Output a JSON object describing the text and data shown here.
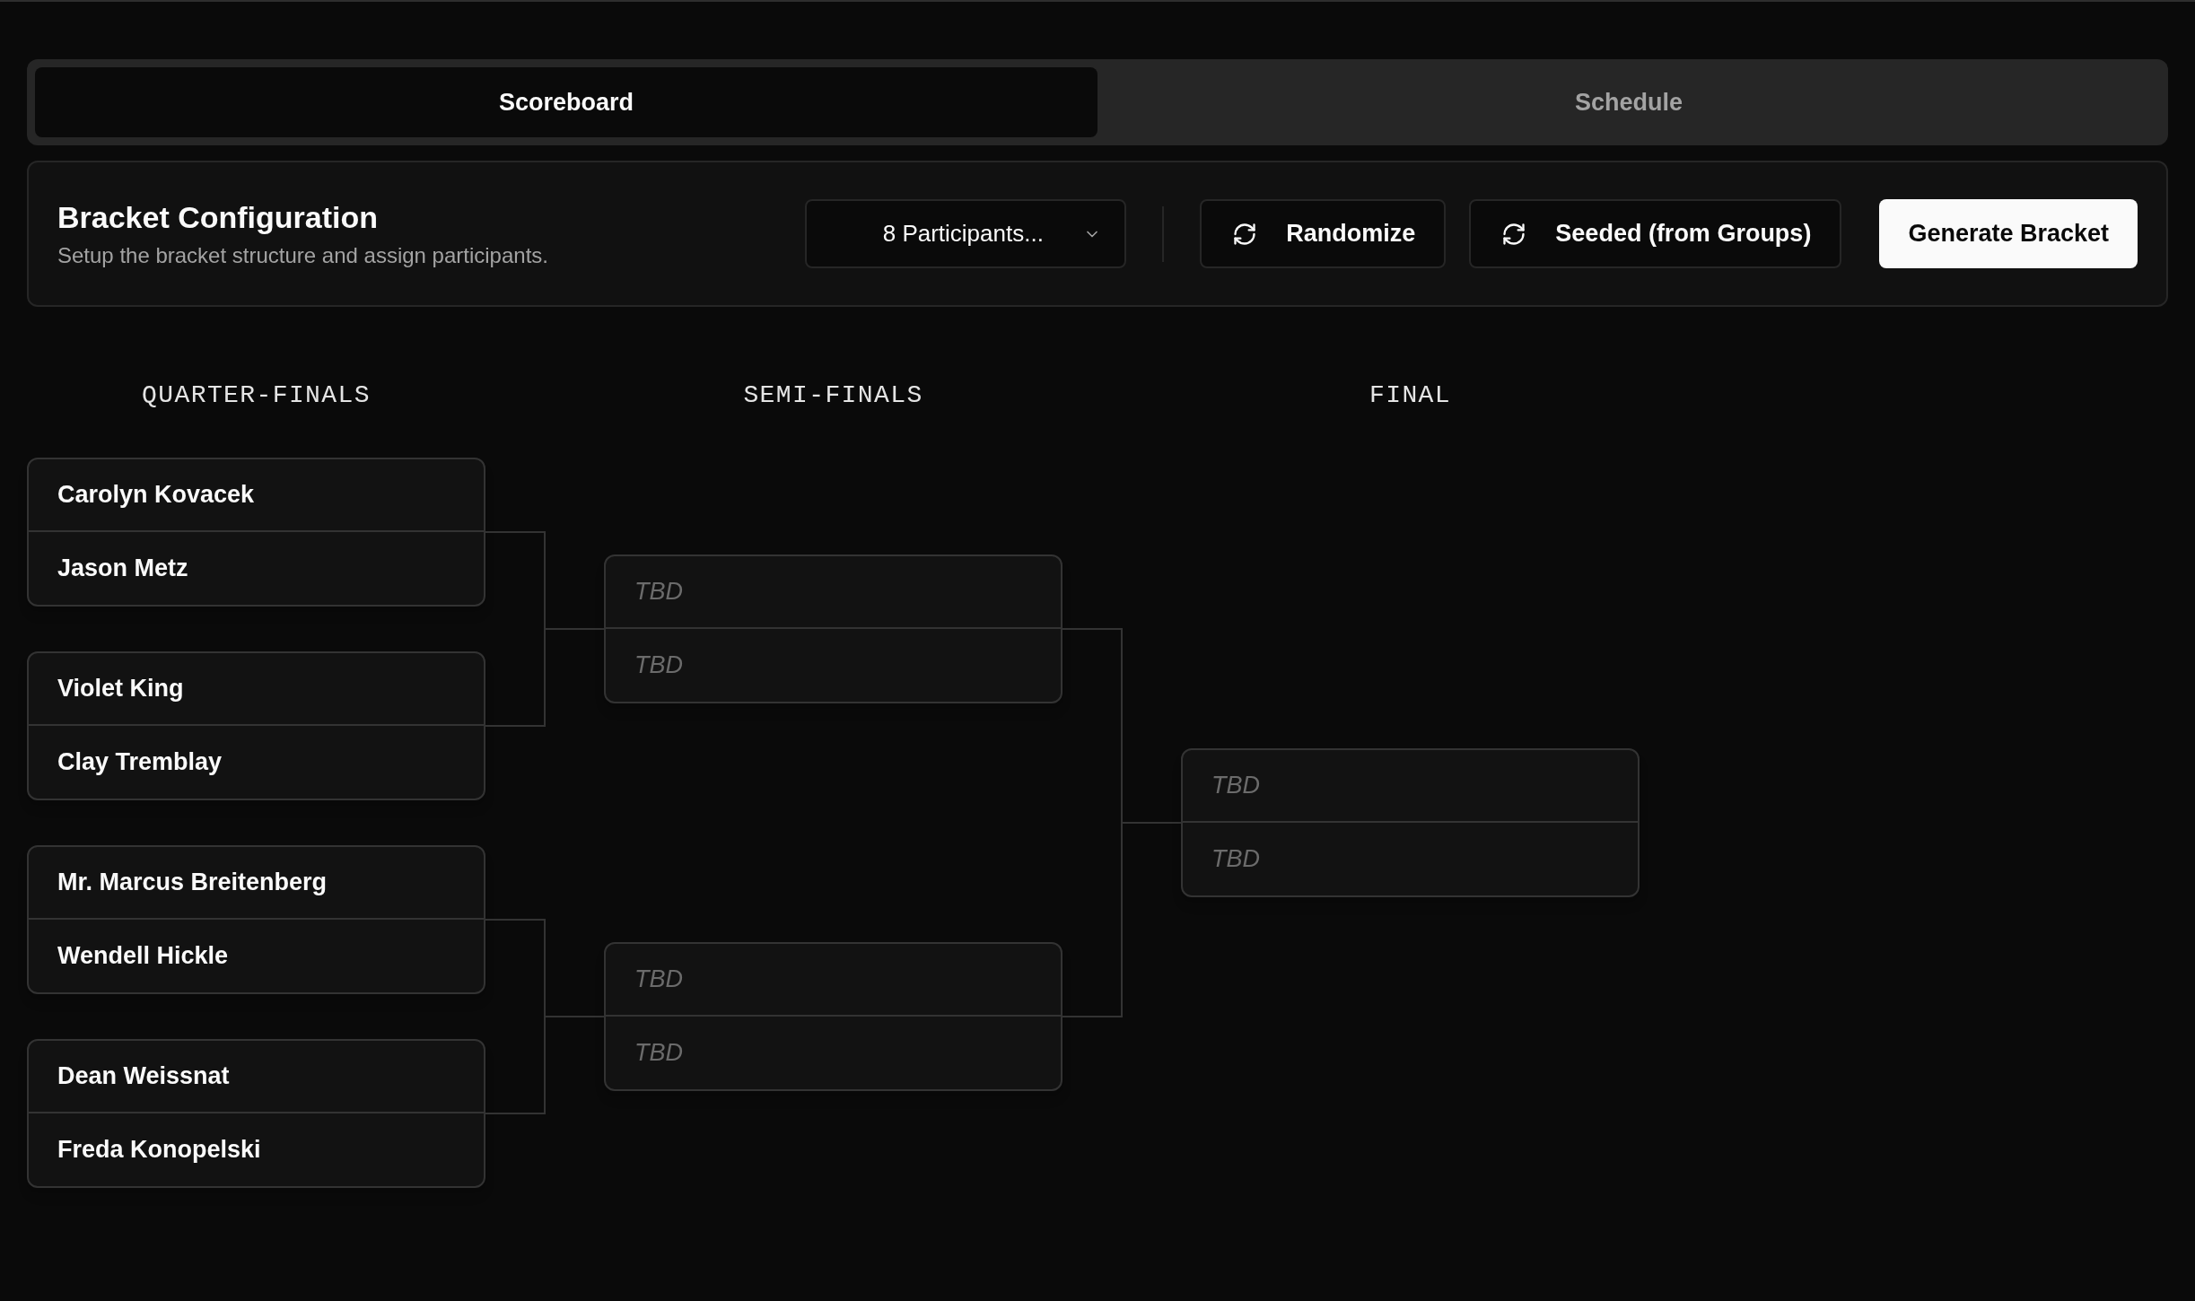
{
  "tabs": [
    {
      "label": "Scoreboard",
      "selected": true
    },
    {
      "label": "Schedule",
      "selected": false
    }
  ],
  "bracket_configuration": {
    "title": "Bracket Configuration",
    "subtitle": "Setup the bracket structure and assign participants.",
    "participants_select": {
      "value": "8 Participants..."
    },
    "buttons": [
      {
        "label": "Randomize",
        "kind": "outline"
      },
      {
        "label": "Seeded (from Groups)",
        "kind": "outline"
      },
      {
        "label": "Generate Bracket",
        "kind": "primary"
      }
    ]
  },
  "rounds": [
    {
      "title": "QUARTER-FINALS",
      "matches": [
        {
          "slots": [
            {
              "name": "Carolyn Kovacek",
              "kind": "player"
            },
            {
              "name": "Jason Metz",
              "kind": "player"
            }
          ]
        },
        {
          "slots": [
            {
              "name": "Violet King",
              "kind": "player"
            },
            {
              "name": "Clay Tremblay",
              "kind": "player"
            }
          ]
        },
        {
          "slots": [
            {
              "name": "Mr. Marcus Breitenberg",
              "kind": "player"
            },
            {
              "name": "Wendell Hickle",
              "kind": "player"
            }
          ]
        },
        {
          "slots": [
            {
              "name": "Dean Weissnat",
              "kind": "player"
            },
            {
              "name": "Freda Konopelski",
              "kind": "player"
            }
          ]
        }
      ]
    },
    {
      "title": "SEMI-FINALS",
      "matches": [
        {
          "slots": [
            {
              "name": "TBD",
              "kind": "tbd"
            },
            {
              "name": "TBD",
              "kind": "tbd"
            }
          ]
        },
        {
          "slots": [
            {
              "name": "TBD",
              "kind": "tbd"
            },
            {
              "name": "TBD",
              "kind": "tbd"
            }
          ]
        }
      ]
    },
    {
      "title": "FINAL",
      "matches": [
        {
          "slots": [
            {
              "name": "TBD",
              "kind": "tbd"
            },
            {
              "name": "TBD",
              "kind": "tbd"
            }
          ]
        }
      ]
    }
  ]
}
